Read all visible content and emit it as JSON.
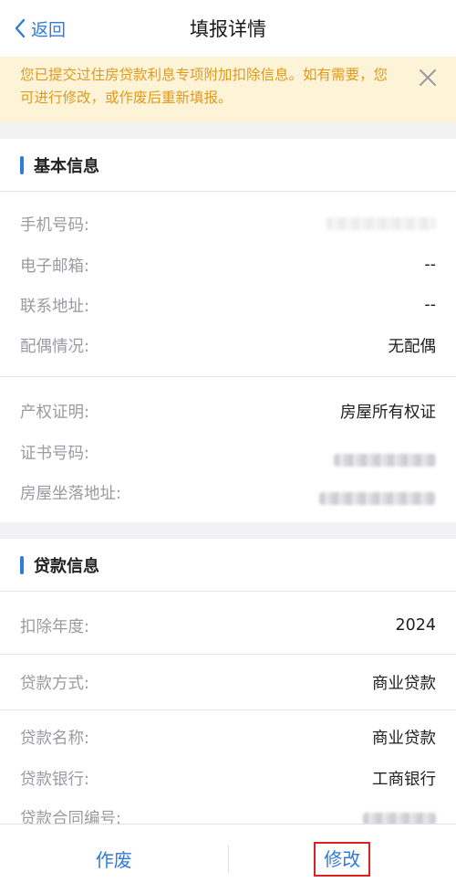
{
  "nav": {
    "back_label": "返回",
    "title": "填报详情"
  },
  "notice": {
    "text": "您已提交过住房贷款利息专项附加扣除信息。如有需要，您可进行修改，或作废后重新填报。"
  },
  "basic": {
    "title": "基本信息",
    "rows": [
      {
        "label": "手机号码:",
        "value": ""
      },
      {
        "label": "电子邮箱:",
        "value": "--"
      },
      {
        "label": "联系地址:",
        "value": "--"
      },
      {
        "label": "配偶情况:",
        "value": "无配偶"
      }
    ]
  },
  "property": {
    "rows": [
      {
        "label": "产权证明:",
        "value": "房屋所有权证"
      },
      {
        "label": "证书号码:",
        "value": ""
      },
      {
        "label": "房屋坐落地址:",
        "value": ""
      }
    ]
  },
  "loan": {
    "title": "贷款信息",
    "year_label": "扣除年度:",
    "year_value": "2024",
    "method_label": "贷款方式:",
    "method_value": "商业贷款",
    "rows": [
      {
        "label": "贷款名称:",
        "value": "商业贷款"
      },
      {
        "label": "贷款银行:",
        "value": "工商银行"
      },
      {
        "label": "贷款合同编号:",
        "value": ""
      }
    ]
  },
  "actions": {
    "void_label": "作废",
    "modify_label": "修改"
  },
  "colors": {
    "accent": "#2f7bd9",
    "notice_bg": "#fdf4d7",
    "notice_text": "#e0991f",
    "highlight": "#e02020"
  }
}
